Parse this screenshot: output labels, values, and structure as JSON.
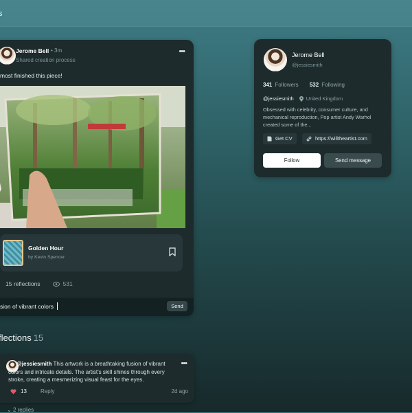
{
  "header": {
    "title": "s"
  },
  "post": {
    "author": "Jerome Bell",
    "time": "• 3m",
    "subtitle": "Shared creation process",
    "caption": "most finished this piece!",
    "item": {
      "title": "Golden Hour",
      "by": "by Kevin Spencer"
    },
    "reflections_count": "15 reflections",
    "views": "531",
    "comment_value": "sion of vibrant colors",
    "send_label": "Send"
  },
  "profile": {
    "name": "Jerome Bell",
    "handle": "@jessiesmith",
    "followers_count": "341",
    "followers_label": "Followers",
    "following_count": "532",
    "following_label": "Following",
    "username": "@jessiesmith",
    "location": "United Kingdom",
    "bio": "Obsessed with celebrity, consumer culture, and mechanical reproduction, Pop artist Andy Warhol created some of the...",
    "cv_label": "Get CV",
    "website": "https://willtheartist.com",
    "follow_label": "Follow",
    "message_label": "Send message"
  },
  "reflections": {
    "title": "flections",
    "count": "15",
    "comments": [
      {
        "user": "@jessiesmith",
        "text": "This artwork is a breathtaking fusion of vibrant colors and intricate details. The artist's skill shines through every stroke, creating a mesmerizing visual feast for the eyes.",
        "likes": "13",
        "reply_label": "Reply",
        "ago": "2d ago"
      }
    ],
    "replies_label": "2 replies"
  },
  "colors": {
    "accent_like": "#e25a6b",
    "follow_bg": "#ffffff"
  },
  "icons": [
    "more-icon",
    "bookmark-icon",
    "comment-icon",
    "eye-icon",
    "location-pin-icon",
    "document-icon",
    "link-icon",
    "heart-icon",
    "chevron-down-icon"
  ]
}
